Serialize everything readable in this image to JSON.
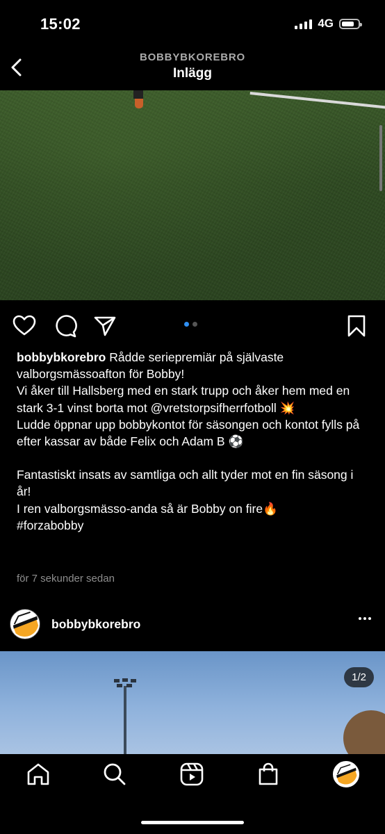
{
  "status_bar": {
    "time": "15:02",
    "network": "4G",
    "battery_level": 0.75
  },
  "header": {
    "account": "BOBBYBKOREBRO",
    "title": "Inlägg"
  },
  "post": {
    "carousel": {
      "count": 2,
      "active_index": 0
    },
    "caption": {
      "username": "bobbybkorebro",
      "first_line": " Rådde seriepremiär på självaste valborgsmässoafton för Bobby!",
      "lines": [
        "Vi åker till Hallsberg med en stark trupp och åker hem med en stark 3-1 vinst borta mot @vretstorpsifherrfotboll 💥",
        "Ludde öppnar upp bobbykontot för säsongen och kontot fylls på efter kassar av både Felix och Adam B ⚽️",
        "",
        "Fantastiskt insats av samtliga och allt tyder mot en fin säsong i år!",
        "I ren valborgsmässo-anda så är Bobby on fire🔥",
        "#forzabobby"
      ]
    },
    "timestamp": "för 7 sekunder sedan"
  },
  "next_post": {
    "username": "bobbybkorebro",
    "counter": "1/2"
  },
  "icons": {
    "back": "chevron-left-icon",
    "like": "heart-icon",
    "comment": "comment-icon",
    "share": "paper-plane-icon",
    "save": "bookmark-icon",
    "home": "home-icon",
    "search": "search-icon",
    "reels": "reels-icon",
    "shop": "shopping-bag-icon"
  },
  "colors": {
    "background": "#000000",
    "accent": "#2f8ff2",
    "muted": "#8e8e8e",
    "logo_orange": "#f5a623"
  }
}
